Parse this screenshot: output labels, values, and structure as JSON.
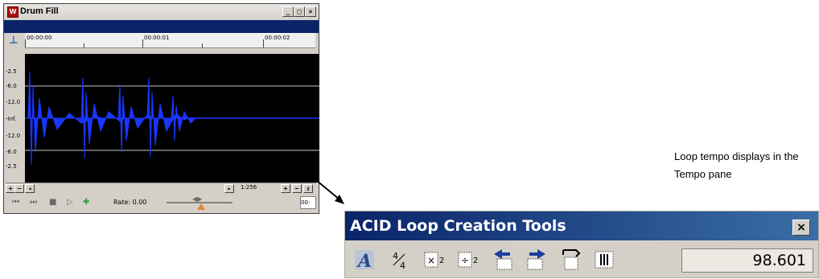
{
  "window": {
    "title": "Drum Fill",
    "icon": "app-icon",
    "buttons": {
      "minimize": "_",
      "maximize": "□",
      "close": "×"
    }
  },
  "ruler": {
    "labels": [
      "00:00:00",
      "00:00:01",
      "00:00:02"
    ]
  },
  "db_scale": [
    "-2.5",
    "-6.0",
    "-12.0",
    "-Inf.",
    "-12.0",
    "-6.0",
    "-2.5"
  ],
  "scrollbar": {
    "zoom_value": "1:256"
  },
  "transport": {
    "rate_label": "Rate: 0.00",
    "position_value": "00:"
  },
  "annotation": {
    "caption": "Loop tempo displays in the Tempo pane"
  },
  "acid_toolbar": {
    "title": "ACID Loop Creation Tools",
    "close_label": "×",
    "tempo_value": "98.601",
    "tools": [
      {
        "name": "acid-a-icon"
      },
      {
        "name": "time-signature-icon",
        "text": "4/4"
      },
      {
        "name": "multiply-beats-icon",
        "text": "×2"
      },
      {
        "name": "divide-beats-icon",
        "text": "÷2"
      },
      {
        "name": "shift-left-icon"
      },
      {
        "name": "shift-right-icon"
      },
      {
        "name": "link-loop-icon"
      },
      {
        "name": "grid-icon"
      }
    ]
  },
  "colors": {
    "title_blue": "#0a246a",
    "waveform": "#1a35ff",
    "panel_bg": "#d4d0c8"
  }
}
